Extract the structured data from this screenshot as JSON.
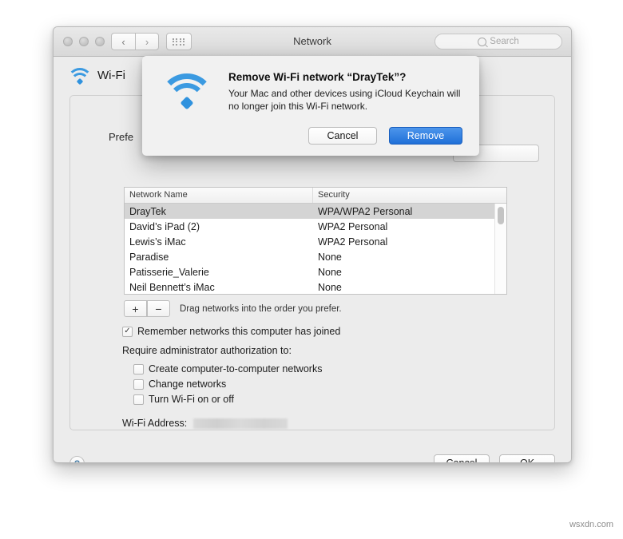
{
  "window": {
    "title": "Network",
    "search_placeholder": "Search",
    "traffic_lights": [
      "close",
      "minimize",
      "maximize"
    ],
    "nav": {
      "back": "‹",
      "forward": "›"
    }
  },
  "panel": {
    "service_name": "Wi-Fi",
    "preferred_label": "Prefe",
    "table": {
      "columns": [
        "Network Name",
        "Security"
      ],
      "rows": [
        {
          "name": "DrayTek",
          "security": "WPA/WPA2 Personal",
          "selected": true
        },
        {
          "name": "David’s iPad (2)",
          "security": "WPA2 Personal",
          "selected": false
        },
        {
          "name": "Lewis’s iMac",
          "security": "WPA2 Personal",
          "selected": false
        },
        {
          "name": "Paradise",
          "security": "None",
          "selected": false
        },
        {
          "name": "Patisserie_Valerie",
          "security": "None",
          "selected": false
        },
        {
          "name": "Neil Bennett’s iMac",
          "security": "None",
          "selected": false
        }
      ]
    },
    "add_button": "+",
    "remove_button": "−",
    "drag_hint": "Drag networks into the order you prefer.",
    "remember_checkbox": {
      "label": "Remember networks this computer has joined",
      "checked": true,
      "mark": "✓"
    },
    "require_label": "Require administrator authorization to:",
    "auth_checkboxes": [
      {
        "label": "Create computer-to-computer networks",
        "checked": false
      },
      {
        "label": "Change networks",
        "checked": false
      },
      {
        "label": "Turn Wi-Fi on or off",
        "checked": false
      }
    ],
    "wifi_address_label": "Wi-Fi Address:",
    "wifi_address_value": ""
  },
  "footer": {
    "help": "?",
    "cancel": "Cancel",
    "ok": "OK"
  },
  "dialog": {
    "title": "Remove Wi-Fi network “DrayTek”?",
    "message": "Your Mac and other devices using iCloud Keychain will no longer join this Wi-Fi network.",
    "cancel": "Cancel",
    "confirm": "Remove",
    "accent_color": "#1f6fd8"
  },
  "watermark": "wsxdn.com"
}
